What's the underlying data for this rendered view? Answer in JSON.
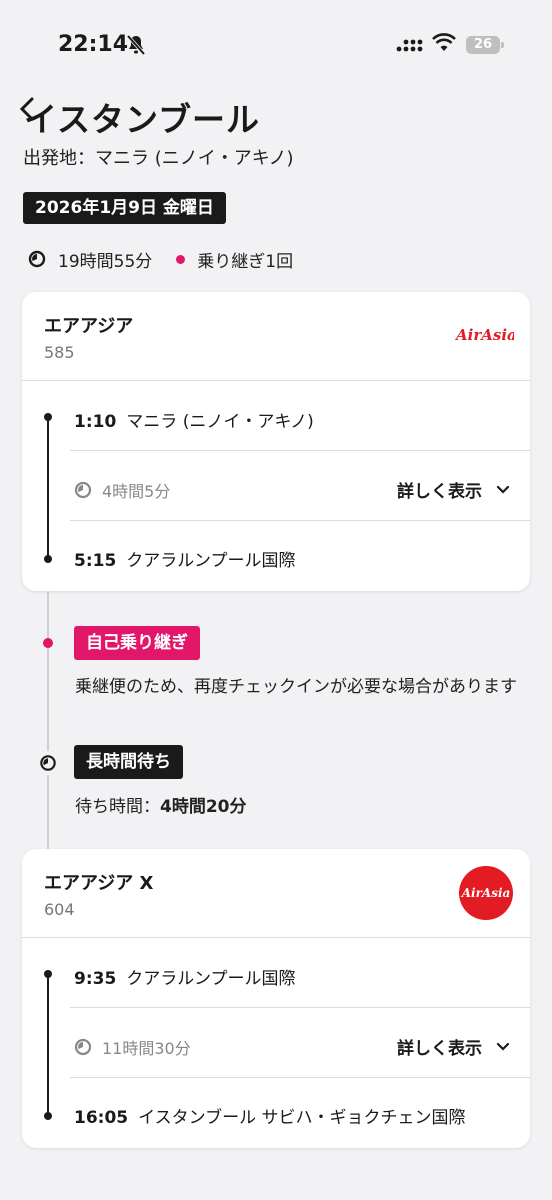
{
  "status_bar": {
    "time": "22:14",
    "battery": "26"
  },
  "header": {
    "title": "イスタンブール",
    "origin": "出発地：マニラ (ニノイ・アキノ)",
    "date": "2026年1月9日 金曜日",
    "total_duration": "19時間55分",
    "transfers": "乗り継ぎ1回"
  },
  "segments": [
    {
      "airline": "エアアジア",
      "flight_no": "585",
      "logo_text": "AirAsia",
      "departure": {
        "time": "1:10",
        "airport": "マニラ (ニノイ・アキノ)"
      },
      "duration": "4時間5分",
      "details_label": "詳しく表示",
      "arrival": {
        "time": "5:15",
        "airport": "クアラルンプール国際"
      }
    },
    {
      "airline": "エアアジア X",
      "flight_no": "604",
      "logo_text": "AirAsia",
      "departure": {
        "time": "9:35",
        "airport": "クアラルンプール国際"
      },
      "duration": "11時間30分",
      "details_label": "詳しく表示",
      "arrival": {
        "time": "16:05",
        "airport": "イスタンブール サビハ・ギョクチェン国際"
      }
    }
  ],
  "connection": {
    "self_transfer_label": "自己乗り継ぎ",
    "self_transfer_note": "乗継便のため、再度チェックインが必要な場合があります",
    "long_wait_label": "長時間待ち",
    "wait_prefix": "待ち時間：",
    "wait_value": "4時間20分"
  },
  "colors": {
    "accent": "#e3176a",
    "dark": "#1a1a1a",
    "airasia_red": "#e31b23"
  }
}
